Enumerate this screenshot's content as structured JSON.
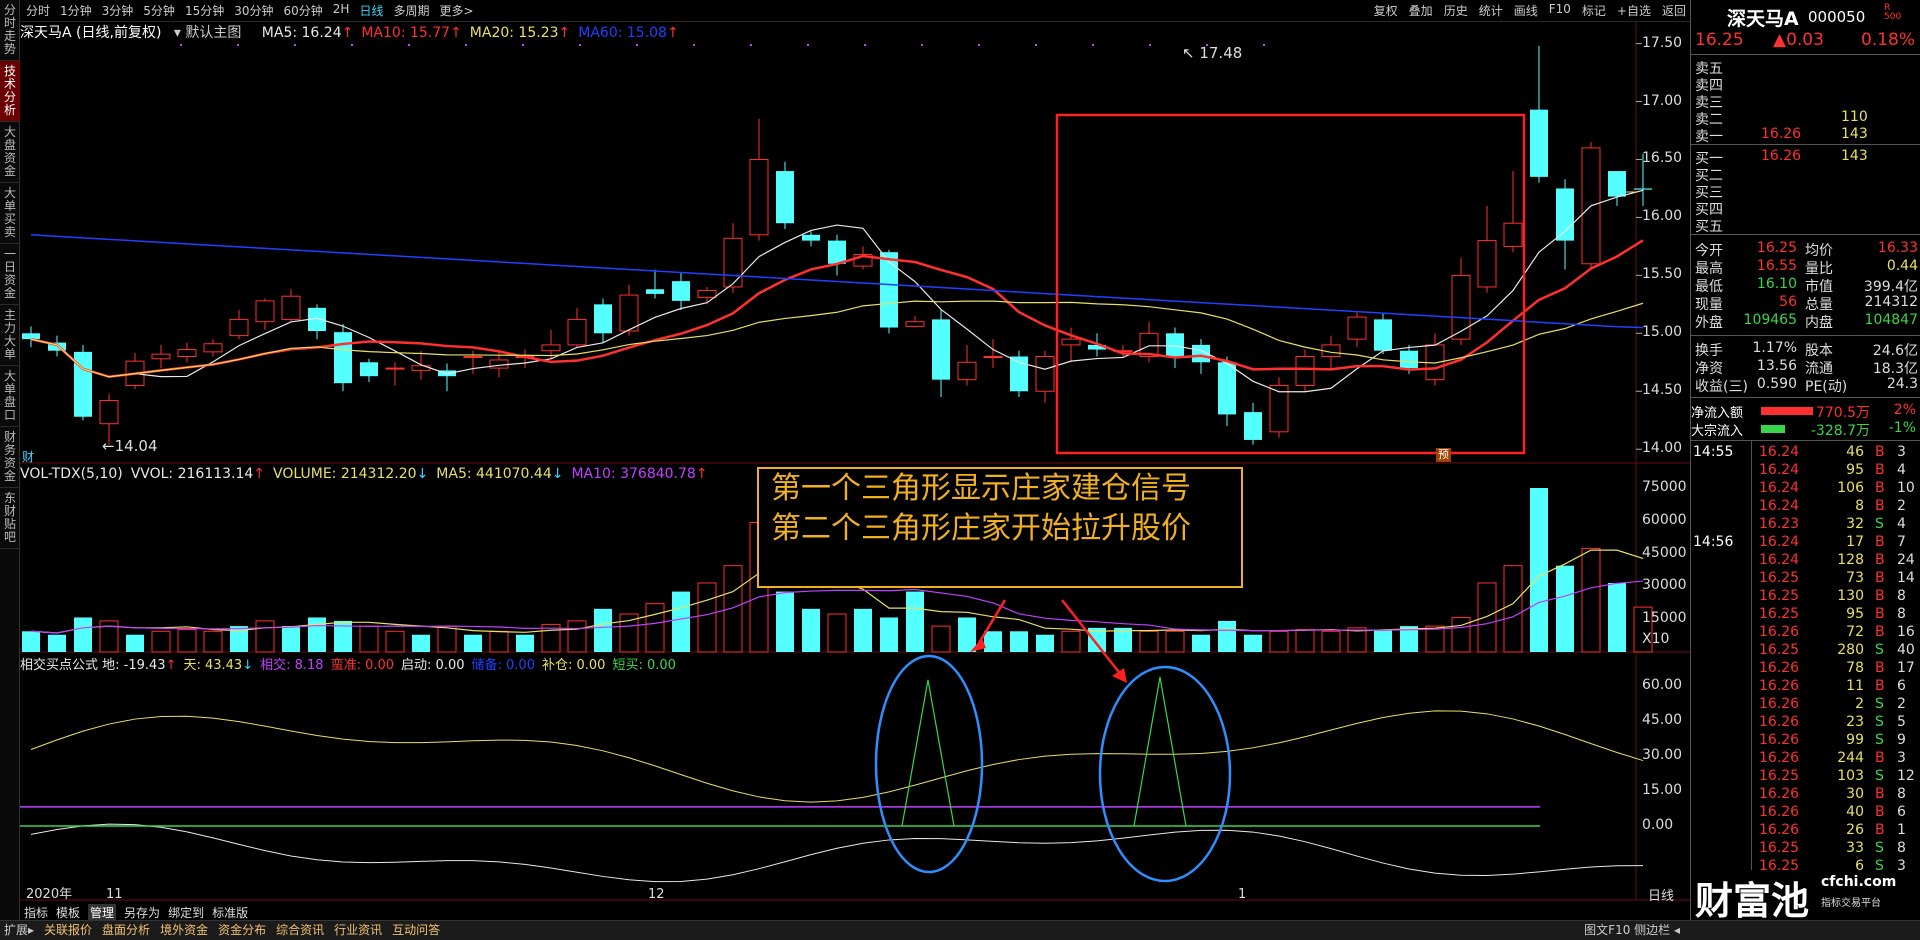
{
  "left_tabs": [
    "分时走势",
    "技术分析",
    "大盘资金",
    "大单买卖",
    "一日资金",
    "主力大单",
    "大单盘口",
    "财务资金",
    "东财贴吧"
  ],
  "topbar": {
    "periods": [
      "分时",
      "1分钟",
      "3分钟",
      "5分钟",
      "15分钟",
      "30分钟",
      "60分钟",
      "2H",
      "日线",
      "多周期",
      "更多>"
    ],
    "active_period": "日线",
    "tools": [
      "复权",
      "叠加",
      "历史",
      "统计",
      "画线",
      "F10",
      "标记",
      "+自选",
      "返回"
    ]
  },
  "main_chart": {
    "title": "深天马A (日线,前复权)",
    "template": "默认主图",
    "ma": [
      {
        "label": "MA5: 16.24",
        "arrow": "↑",
        "color": "#e8e8e8"
      },
      {
        "label": "MA10: 15.77",
        "arrow": "↑",
        "color": "#ff3030"
      },
      {
        "label": "MA20: 15.23",
        "arrow": "↑",
        "color": "#e8e060"
      },
      {
        "label": "MA60: 15.08",
        "arrow": "↑",
        "color": "#2040ff"
      }
    ],
    "y_ticks": [
      "17.50",
      "17.00",
      "16.50",
      "16.00",
      "15.50",
      "15.00",
      "14.50",
      "14.00"
    ],
    "high_label": "17.48",
    "low_label": "14.04",
    "marker_cai": "财",
    "marker_yu": "预"
  },
  "vol_chart": {
    "items": [
      {
        "label": "VOL-TDX(5,10)",
        "color": "#e8e8e8"
      },
      {
        "label": "VVOL: 216113.14",
        "arrow": "↑",
        "color": "#e8e8e8"
      },
      {
        "label": "VOLUME: 214312.20",
        "arrow": "↓",
        "color": "#e8e060"
      },
      {
        "label": "MA5: 441070.44",
        "arrow": "↓",
        "color": "#e8e060"
      },
      {
        "label": "MA10: 376840.78",
        "arrow": "↑",
        "color": "#c040ff"
      }
    ],
    "y_ticks": [
      "75000",
      "60000",
      "45000",
      "30000",
      "15000",
      "X10"
    ]
  },
  "ind_chart": {
    "items": [
      {
        "label": "相交买点公式 地: -19.43",
        "arrow": "↑",
        "color": "#e8e8e8"
      },
      {
        "label": "天: 43.43",
        "arrow": "↓",
        "color": "#e8e060"
      },
      {
        "label": "相交: 8.18",
        "color": "#c040ff"
      },
      {
        "label": "蛮准: 0.00",
        "color": "#ff3030"
      },
      {
        "label": "启动: 0.00",
        "color": "#e8e8e8"
      },
      {
        "label": "储备: 0.00",
        "color": "#2040ff"
      },
      {
        "label": "补仓: 0.00",
        "color": "#e8e060"
      },
      {
        "label": "短买: 0.00",
        "color": "#3ad64a"
      }
    ],
    "y_ticks": [
      "60.00",
      "45.00",
      "30.00",
      "15.00",
      "0.00"
    ]
  },
  "annotation": {
    "line1": "第一个三角形显示庄家建仓信号",
    "line2": "第二个三角形庄家开始拉升股价"
  },
  "x_axis": {
    "year": "2020年",
    "m11": "11",
    "m12": "12",
    "m1": "1",
    "period_label": "日线"
  },
  "bottom_tabs": [
    "指标",
    "模板",
    "管理",
    "另存为",
    "绑定到",
    "标准版"
  ],
  "status_tabs": [
    "扩展▸",
    "关联报价",
    "盘面分析",
    "境外资金",
    "资金分布",
    "综合资讯",
    "行业资讯",
    "互动问答"
  ],
  "status_right": "图文F10 侧边栏 ◂",
  "quote": {
    "name": "深天马A",
    "code": "000050",
    "price": "16.25",
    "change": "▲0.03",
    "pct": "0.18%",
    "asks": [
      {
        "label": "卖五",
        "price": "",
        "vol": ""
      },
      {
        "label": "卖四",
        "price": "",
        "vol": ""
      },
      {
        "label": "卖三",
        "price": "",
        "vol": ""
      },
      {
        "label": "卖二",
        "price": "",
        "vol": "110"
      },
      {
        "label": "卖一",
        "price": "16.26",
        "vol": "143"
      }
    ],
    "bids": [
      {
        "label": "买一",
        "price": "16.26",
        "vol": "143"
      },
      {
        "label": "买二",
        "price": "",
        "vol": ""
      },
      {
        "label": "买三",
        "price": "",
        "vol": ""
      },
      {
        "label": "买四",
        "price": "",
        "vol": ""
      },
      {
        "label": "买五",
        "price": "",
        "vol": ""
      }
    ],
    "stats": [
      [
        "今开",
        "16.25",
        "均价",
        "16.33"
      ],
      [
        "最高",
        "16.55",
        "量比",
        "0.44"
      ],
      [
        "最低",
        "16.10",
        "市值",
        "399.4亿"
      ],
      [
        "现量",
        "56",
        "总量",
        "214312"
      ],
      [
        "外盘",
        "109465",
        "内盘",
        "104847"
      ]
    ],
    "stats2": [
      [
        "换手",
        "1.17%",
        "股本",
        "24.6亿"
      ],
      [
        "净资",
        "13.56",
        "流通",
        "18.3亿"
      ],
      [
        "收益(三)",
        "0.590",
        "PE(动)",
        "24.3"
      ]
    ],
    "flows": [
      {
        "label": "净流入额",
        "value": "770.5万",
        "pct": "2%",
        "color": "#ff3030"
      },
      {
        "label": "大宗流入",
        "value": "-328.7万",
        "pct": "-1%",
        "color": "#3ad64a"
      }
    ],
    "ticks_time1": "14:55",
    "ticks_time2": "14:56",
    "ticks": [
      [
        "16.24",
        "46",
        "B",
        "3"
      ],
      [
        "16.24",
        "95",
        "B",
        "4"
      ],
      [
        "16.24",
        "106",
        "B",
        "10"
      ],
      [
        "16.24",
        "8",
        "B",
        "2"
      ],
      [
        "16.23",
        "32",
        "S",
        "4"
      ],
      [
        "16.24",
        "17",
        "B",
        "7"
      ],
      [
        "16.24",
        "128",
        "B",
        "24"
      ],
      [
        "16.25",
        "73",
        "B",
        "14"
      ],
      [
        "16.25",
        "130",
        "B",
        "8"
      ],
      [
        "16.25",
        "95",
        "B",
        "8"
      ],
      [
        "16.26",
        "72",
        "B",
        "16"
      ],
      [
        "16.25",
        "280",
        "S",
        "40"
      ],
      [
        "16.26",
        "78",
        "B",
        "17"
      ],
      [
        "16.26",
        "11",
        "B",
        "6"
      ],
      [
        "16.26",
        "2",
        "S",
        "2"
      ],
      [
        "16.26",
        "23",
        "S",
        "5"
      ],
      [
        "16.26",
        "99",
        "S",
        "9"
      ],
      [
        "16.26",
        "244",
        "B",
        "3"
      ],
      [
        "16.25",
        "103",
        "S",
        "12"
      ],
      [
        "16.26",
        "30",
        "B",
        "8"
      ],
      [
        "16.26",
        "40",
        "B",
        "6"
      ],
      [
        "16.26",
        "26",
        "B",
        "1"
      ],
      [
        "16.25",
        "33",
        "S",
        "8"
      ],
      [
        "16.25",
        "6",
        "S",
        "3"
      ]
    ],
    "watermark": "财富池",
    "watermark_sub1": "cfchi.com",
    "watermark_sub2": "指标交易平台"
  },
  "candles": [
    [
      15.0,
      14.95,
      15.06,
      14.88
    ],
    [
      14.92,
      14.85,
      14.98,
      14.8
    ],
    [
      14.84,
      14.28,
      14.9,
      14.25
    ],
    [
      14.22,
      14.42,
      14.48,
      14.04
    ],
    [
      14.55,
      14.76,
      14.83,
      14.52
    ],
    [
      14.78,
      14.82,
      14.9,
      14.7
    ],
    [
      14.8,
      14.86,
      14.92,
      14.75
    ],
    [
      14.84,
      14.91,
      14.95,
      14.8
    ],
    [
      14.98,
      15.12,
      15.2,
      14.95
    ],
    [
      15.1,
      15.28,
      15.3,
      15.03
    ],
    [
      15.12,
      15.32,
      15.38,
      15.1
    ],
    [
      15.22,
      15.02,
      15.25,
      14.95
    ],
    [
      15.01,
      14.57,
      15.08,
      14.5
    ],
    [
      14.75,
      14.63,
      14.78,
      14.58
    ],
    [
      14.7,
      14.7,
      14.75,
      14.55
    ],
    [
      14.68,
      14.72,
      14.85,
      14.6
    ],
    [
      14.68,
      14.63,
      14.74,
      14.5
    ],
    [
      14.8,
      14.8,
      14.85,
      14.65
    ],
    [
      14.7,
      14.77,
      14.86,
      14.62
    ],
    [
      14.8,
      14.8,
      14.86,
      14.7
    ],
    [
      14.85,
      14.9,
      15.03,
      14.78
    ],
    [
      14.9,
      15.12,
      15.22,
      14.88
    ],
    [
      15.25,
      15.0,
      15.3,
      14.92
    ],
    [
      15.02,
      15.33,
      15.42,
      14.98
    ],
    [
      15.38,
      15.34,
      15.55,
      15.3
    ],
    [
      15.45,
      15.28,
      15.52,
      15.2
    ],
    [
      15.31,
      15.37,
      15.4,
      15.25
    ],
    [
      15.4,
      15.82,
      15.95,
      15.35
    ],
    [
      15.85,
      16.5,
      16.85,
      15.8
    ],
    [
      16.4,
      15.95,
      16.48,
      15.9
    ],
    [
      15.85,
      15.8,
      15.88,
      15.75
    ],
    [
      15.8,
      15.6,
      15.85,
      15.5
    ],
    [
      15.58,
      15.68,
      15.75,
      15.55
    ],
    [
      15.7,
      15.05,
      15.72,
      15.0
    ],
    [
      15.06,
      15.1,
      15.15,
      15.05
    ],
    [
      15.12,
      14.6,
      15.2,
      14.45
    ],
    [
      14.6,
      14.75,
      14.9,
      14.55
    ],
    [
      14.8,
      14.8,
      14.95,
      14.7
    ],
    [
      14.8,
      14.5,
      14.85,
      14.45
    ],
    [
      14.5,
      14.8,
      14.85,
      14.4
    ],
    [
      14.9,
      14.95,
      15.05,
      14.75
    ],
    [
      14.9,
      14.86,
      15.0,
      14.8
    ],
    [
      14.85,
      14.85,
      14.9,
      14.8
    ],
    [
      14.8,
      15.0,
      15.1,
      14.75
    ],
    [
      15.0,
      14.8,
      15.05,
      14.7
    ],
    [
      14.9,
      14.75,
      14.95,
      14.65
    ],
    [
      14.75,
      14.3,
      14.8,
      14.2
    ],
    [
      14.32,
      14.08,
      14.4,
      14.04
    ],
    [
      14.15,
      14.55,
      14.62,
      14.1
    ],
    [
      14.55,
      14.8,
      14.86,
      14.5
    ],
    [
      14.8,
      14.9,
      14.98,
      14.7
    ],
    [
      14.95,
      15.14,
      15.18,
      14.88
    ],
    [
      15.12,
      14.85,
      15.18,
      14.82
    ],
    [
      14.85,
      14.7,
      14.9,
      14.65
    ],
    [
      14.6,
      14.9,
      15.0,
      14.55
    ],
    [
      14.95,
      15.5,
      15.65,
      14.9
    ],
    [
      15.4,
      15.8,
      16.1,
      15.35
    ],
    [
      15.75,
      15.95,
      16.4,
      15.7
    ],
    [
      16.93,
      16.35,
      17.48,
      16.3
    ],
    [
      16.25,
      15.8,
      16.33,
      15.55
    ],
    [
      15.6,
      16.6,
      16.65,
      15.55
    ],
    [
      16.4,
      16.18,
      16.4,
      16.1
    ],
    [
      16.25,
      16.24,
      16.55,
      16.1
    ]
  ],
  "volumes": [
    [
      12,
      0
    ],
    [
      10,
      0
    ],
    [
      20,
      0
    ],
    [
      18,
      1
    ],
    [
      10,
      0
    ],
    [
      12,
      1
    ],
    [
      13,
      1
    ],
    [
      12,
      1
    ],
    [
      15,
      0
    ],
    [
      18,
      1
    ],
    [
      15,
      0
    ],
    [
      20,
      0
    ],
    [
      18,
      0
    ],
    [
      15,
      1
    ],
    [
      12,
      1
    ],
    [
      10,
      0
    ],
    [
      15,
      1
    ],
    [
      10,
      0
    ],
    [
      12,
      1
    ],
    [
      10,
      0
    ],
    [
      16,
      1
    ],
    [
      18,
      1
    ],
    [
      25,
      0
    ],
    [
      22,
      1
    ],
    [
      28,
      1
    ],
    [
      35,
      0
    ],
    [
      40,
      1
    ],
    [
      50,
      1
    ],
    [
      75,
      1
    ],
    [
      35,
      0
    ],
    [
      25,
      0
    ],
    [
      22,
      1
    ],
    [
      25,
      0
    ],
    [
      20,
      0
    ],
    [
      35,
      0
    ],
    [
      15,
      1
    ],
    [
      20,
      0
    ],
    [
      12,
      0
    ],
    [
      12,
      0
    ],
    [
      10,
      0
    ],
    [
      12,
      1
    ],
    [
      14,
      0
    ],
    [
      14,
      0
    ],
    [
      12,
      1
    ],
    [
      12,
      1
    ],
    [
      10,
      0
    ],
    [
      18,
      0
    ],
    [
      10,
      0
    ],
    [
      12,
      1
    ],
    [
      13,
      1
    ],
    [
      12,
      1
    ],
    [
      14,
      1
    ],
    [
      13,
      0
    ],
    [
      15,
      0
    ],
    [
      15,
      1
    ],
    [
      20,
      1
    ],
    [
      40,
      1
    ],
    [
      50,
      1
    ],
    [
      95,
      0
    ],
    [
      50,
      0
    ],
    [
      60,
      1
    ],
    [
      40,
      0
    ],
    [
      26,
      1
    ]
  ]
}
